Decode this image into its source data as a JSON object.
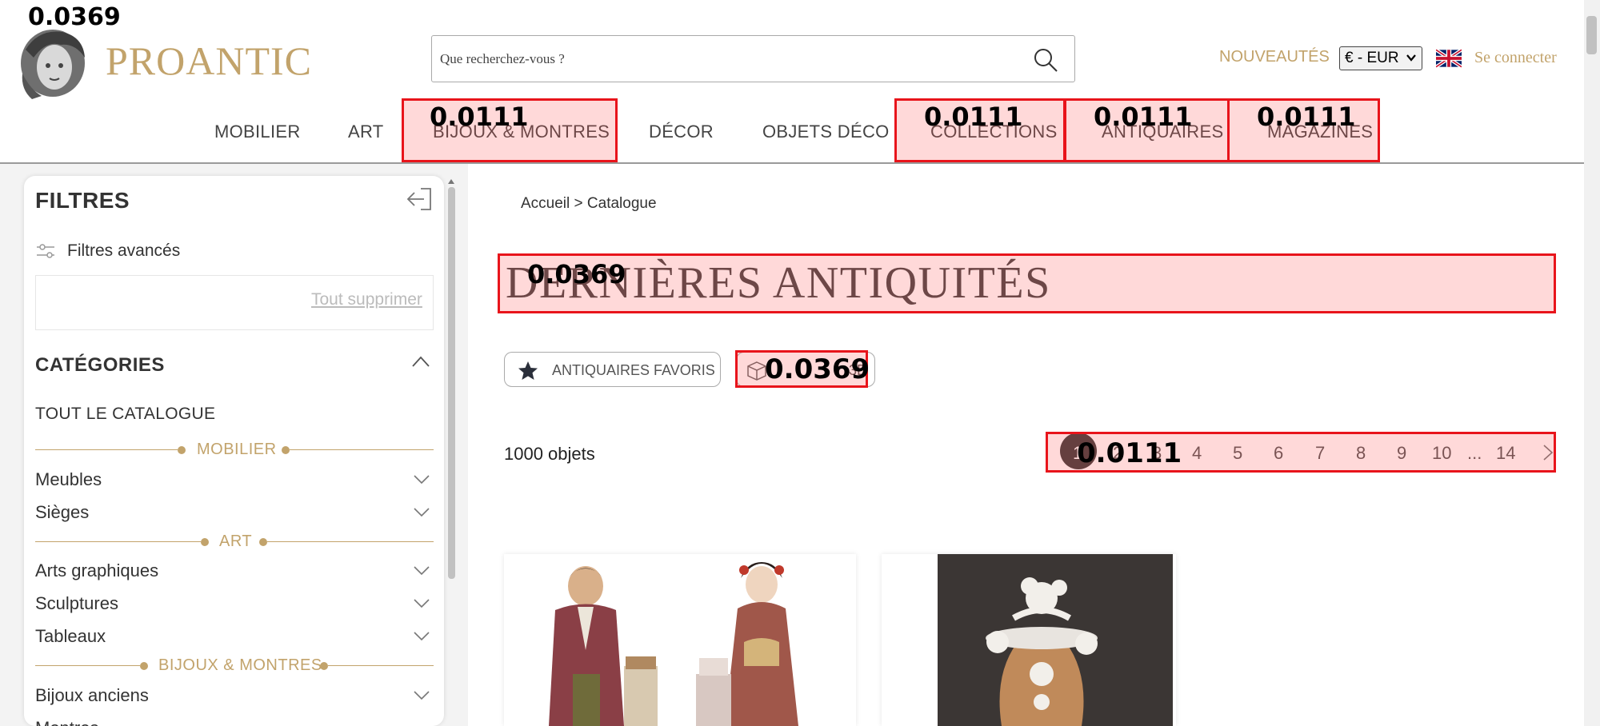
{
  "header": {
    "brand": "PROANTIC",
    "search_placeholder": "Que recherchez-vous ?",
    "nouveautes": "NOUVEAUTÉS",
    "currency": "€ - EUR",
    "login": "Se connecter"
  },
  "nav": {
    "items": [
      "MOBILIER",
      "ART",
      "BIJOUX & MONTRES",
      "DÉCOR",
      "OBJETS DÉCO",
      "COLLECTIONS",
      "ANTIQUAIRES",
      "MAGAZINES"
    ]
  },
  "sidebar": {
    "title": "FILTRES",
    "advanced_filters": "Filtres avancés",
    "clear_all": "Tout supprimer",
    "categories_title": "CATÉGORIES",
    "all_catalog": "TOUT LE CATALOGUE",
    "sections": [
      "MOBILIER",
      "ART",
      "BIJOUX & MONTRES"
    ],
    "rows": [
      "Meubles",
      "Sièges",
      "Arts graphiques",
      "Sculptures",
      "Tableaux",
      "Bijoux anciens",
      "Montres"
    ]
  },
  "main": {
    "breadcrumb": "Accueil > Catalogue",
    "title": "DERNIÈRES ANTIQUITÉS",
    "fav_button": "ANTIQUAIRES FAVORIS",
    "second_button": "3D",
    "object_count": "1000 objets",
    "pages": [
      "1",
      "2",
      "3",
      "4",
      "5",
      "6",
      "7",
      "8",
      "9",
      "10",
      "...",
      "14"
    ]
  },
  "annotations": {
    "scores": [
      "0.0369",
      "0.0111",
      "0.0111",
      "0.0111",
      "0.0111",
      "0.0369",
      "0.0369",
      "0.0111"
    ]
  },
  "colors": {
    "brand_gold": "#c2a36b",
    "annotation_red": "#e8141b",
    "text_dark": "#333333"
  }
}
